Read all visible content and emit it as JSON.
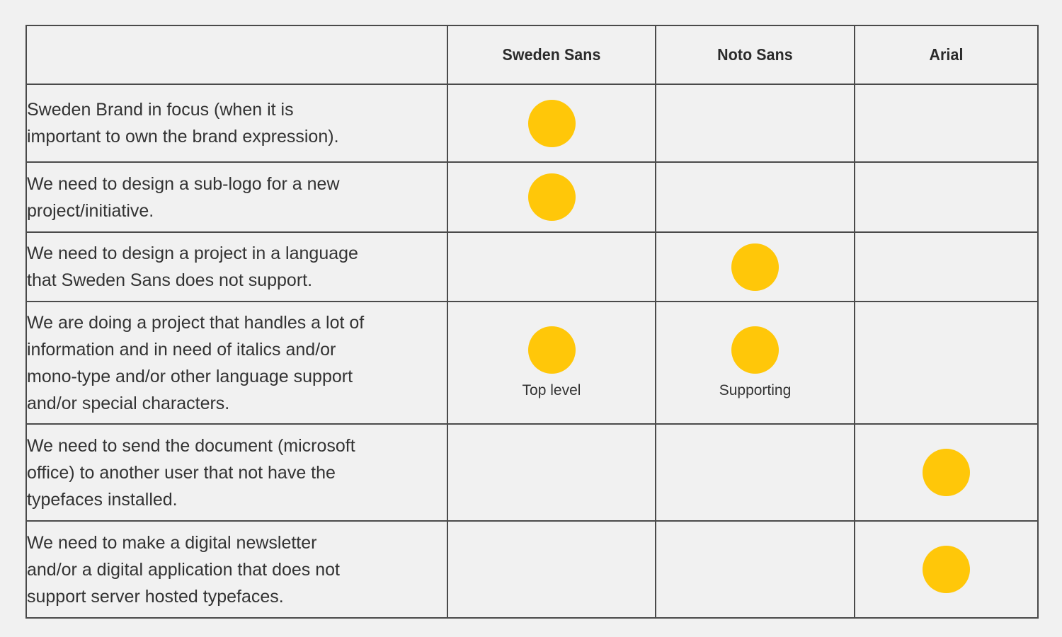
{
  "theme": {
    "page_background": "#f1f1f1",
    "cell_background": "#f1f1f1",
    "border_color": "#4a4a4a",
    "dot_color": "#ffc709",
    "heading_text_color": "#2b2b2b",
    "body_text_color": "#333333"
  },
  "table": {
    "corner_label": "",
    "columns": [
      {
        "id": "criteria",
        "label": ""
      },
      {
        "id": "sweden_sans",
        "label": "Sweden Sans"
      },
      {
        "id": "noto_sans",
        "label": "Noto Sans"
      },
      {
        "id": "arial",
        "label": "Arial"
      }
    ],
    "rows": [
      {
        "criteria": "Sweden Brand in focus (when it is\nimportant to own the brand expression).",
        "marks": [
          {
            "column": "sweden_sans",
            "marked": true,
            "label": ""
          },
          {
            "column": "noto_sans",
            "marked": false,
            "label": ""
          },
          {
            "column": "arial",
            "marked": false,
            "label": ""
          }
        ]
      },
      {
        "criteria": "We need to design a sub-logo for a new\nproject/initiative.",
        "marks": [
          {
            "column": "sweden_sans",
            "marked": true,
            "label": ""
          },
          {
            "column": "noto_sans",
            "marked": false,
            "label": ""
          },
          {
            "column": "arial",
            "marked": false,
            "label": ""
          }
        ]
      },
      {
        "criteria": "We need to design a project in a language\nthat Sweden Sans does not support.",
        "marks": [
          {
            "column": "sweden_sans",
            "marked": false,
            "label": ""
          },
          {
            "column": "noto_sans",
            "marked": true,
            "label": ""
          },
          {
            "column": "arial",
            "marked": false,
            "label": ""
          }
        ]
      },
      {
        "criteria": "We are doing a project that handles a lot of\ninformation and in need of italics and/or\nmono-type and/or other language support\nand/or special characters.",
        "marks": [
          {
            "column": "sweden_sans",
            "marked": true,
            "label": "Top level"
          },
          {
            "column": "noto_sans",
            "marked": true,
            "label": "Supporting"
          },
          {
            "column": "arial",
            "marked": false,
            "label": ""
          }
        ]
      },
      {
        "criteria": "We need to send the document (microsoft\noffice) to another user that not have the\ntypefaces installed.",
        "marks": [
          {
            "column": "sweden_sans",
            "marked": false,
            "label": ""
          },
          {
            "column": "noto_sans",
            "marked": false,
            "label": ""
          },
          {
            "column": "arial",
            "marked": true,
            "label": ""
          }
        ]
      },
      {
        "criteria": "We need to make a digital newsletter\nand/or a digital application that does not\nsupport server hosted typefaces.",
        "marks": [
          {
            "column": "sweden_sans",
            "marked": false,
            "label": ""
          },
          {
            "column": "noto_sans",
            "marked": false,
            "label": ""
          },
          {
            "column": "arial",
            "marked": true,
            "label": ""
          }
        ]
      }
    ]
  }
}
